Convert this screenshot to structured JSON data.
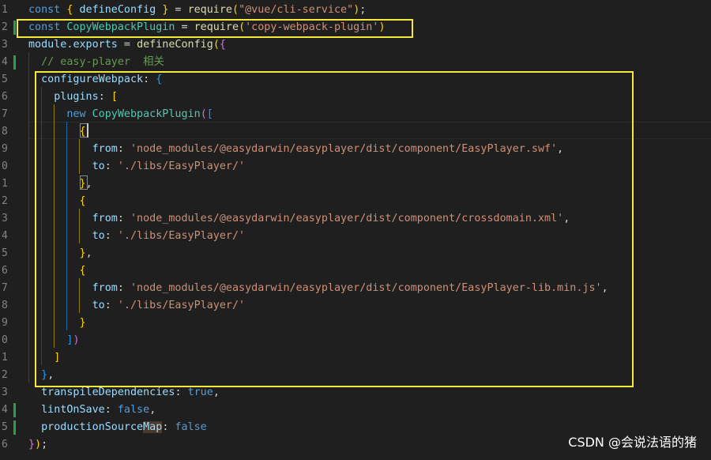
{
  "editor": {
    "lines": [
      {
        "n": "1",
        "tokens": [
          [
            "kw",
            "const "
          ],
          [
            "b1",
            "{ "
          ],
          [
            "var",
            "defineConfig "
          ],
          [
            "b1",
            "}"
          ],
          [
            "pl",
            " = "
          ],
          [
            "fn",
            "require"
          ],
          [
            "b1",
            "("
          ],
          [
            "str",
            "\"@vue/cli-service\""
          ],
          [
            "b1",
            ")"
          ],
          [
            "pl",
            ";"
          ]
        ]
      },
      {
        "n": "2",
        "tokens": [
          [
            "kw",
            "const "
          ],
          [
            "cls",
            "CopyWebpackPlugin"
          ],
          [
            "pl",
            " = "
          ],
          [
            "fn",
            "require"
          ],
          [
            "b1",
            "("
          ],
          [
            "str",
            "'copy-webpack-plugin'"
          ],
          [
            "b1",
            ")"
          ]
        ]
      },
      {
        "n": "3",
        "tokens": [
          [
            "var",
            "module"
          ],
          [
            "pl",
            "."
          ],
          [
            "var",
            "exports"
          ],
          [
            "pl",
            " = "
          ],
          [
            "fn",
            "defineConfig"
          ],
          [
            "b1",
            "("
          ],
          [
            "b2",
            "{"
          ]
        ]
      },
      {
        "n": "4",
        "tokens": [
          [
            "pl",
            "  "
          ],
          [
            "cm",
            "// easy-player  相关"
          ]
        ]
      },
      {
        "n": "5",
        "tokens": [
          [
            "pl",
            "  "
          ],
          [
            "prop",
            "configureWebpack"
          ],
          [
            "pl",
            ": "
          ],
          [
            "b3",
            "{"
          ]
        ]
      },
      {
        "n": "6",
        "tokens": [
          [
            "pl",
            "    "
          ],
          [
            "prop",
            "plugins"
          ],
          [
            "pl",
            ": "
          ],
          [
            "b1",
            "["
          ]
        ]
      },
      {
        "n": "7",
        "tokens": [
          [
            "pl",
            "      "
          ],
          [
            "kw",
            "new "
          ],
          [
            "cls",
            "CopyWebpackPlugin"
          ],
          [
            "b2",
            "("
          ],
          [
            "b3",
            "["
          ]
        ]
      },
      {
        "n": "8",
        "tokens": [
          [
            "pl",
            "        "
          ],
          [
            "b1",
            "{"
          ]
        ]
      },
      {
        "n": "9",
        "tokens": [
          [
            "pl",
            "          "
          ],
          [
            "prop",
            "from"
          ],
          [
            "pl",
            ": "
          ],
          [
            "str",
            "'node_modules/@easydarwin/easyplayer/dist/component/EasyPlayer.swf'"
          ],
          [
            "pl",
            ","
          ]
        ]
      },
      {
        "n": "0",
        "tokens": [
          [
            "pl",
            "          "
          ],
          [
            "prop",
            "to"
          ],
          [
            "pl",
            ": "
          ],
          [
            "str",
            "'./libs/EasyPlayer/'"
          ]
        ]
      },
      {
        "n": "1",
        "tokens": [
          [
            "pl",
            "        "
          ],
          [
            "b1",
            "}"
          ],
          [
            "pl",
            ","
          ]
        ]
      },
      {
        "n": "2",
        "tokens": [
          [
            "pl",
            "        "
          ],
          [
            "b1",
            "{"
          ]
        ]
      },
      {
        "n": "3",
        "tokens": [
          [
            "pl",
            "          "
          ],
          [
            "prop",
            "from"
          ],
          [
            "pl",
            ": "
          ],
          [
            "str",
            "'node_modules/@easydarwin/easyplayer/dist/component/crossdomain.xml'"
          ],
          [
            "pl",
            ","
          ]
        ]
      },
      {
        "n": "4",
        "tokens": [
          [
            "pl",
            "          "
          ],
          [
            "prop",
            "to"
          ],
          [
            "pl",
            ": "
          ],
          [
            "str",
            "'./libs/EasyPlayer/'"
          ]
        ]
      },
      {
        "n": "5",
        "tokens": [
          [
            "pl",
            "        "
          ],
          [
            "b1",
            "}"
          ],
          [
            "pl",
            ","
          ]
        ]
      },
      {
        "n": "6",
        "tokens": [
          [
            "pl",
            "        "
          ],
          [
            "b1",
            "{"
          ]
        ]
      },
      {
        "n": "7",
        "tokens": [
          [
            "pl",
            "          "
          ],
          [
            "prop",
            "from"
          ],
          [
            "pl",
            ": "
          ],
          [
            "str",
            "'node_modules/@easydarwin/easyplayer/dist/component/EasyPlayer-lib.min.js'"
          ],
          [
            "pl",
            ","
          ]
        ]
      },
      {
        "n": "8",
        "tokens": [
          [
            "pl",
            "          "
          ],
          [
            "prop",
            "to"
          ],
          [
            "pl",
            ": "
          ],
          [
            "str",
            "'./libs/EasyPlayer/'"
          ]
        ]
      },
      {
        "n": "9",
        "tokens": [
          [
            "pl",
            "        "
          ],
          [
            "b1",
            "}"
          ]
        ]
      },
      {
        "n": "0",
        "tokens": [
          [
            "pl",
            "      "
          ],
          [
            "b3",
            "]"
          ],
          [
            "b2",
            ")"
          ]
        ]
      },
      {
        "n": "1",
        "tokens": [
          [
            "pl",
            "    "
          ],
          [
            "b1",
            "]"
          ]
        ]
      },
      {
        "n": "2",
        "tokens": [
          [
            "pl",
            "  "
          ],
          [
            "b3",
            "}"
          ],
          [
            "pl",
            ","
          ]
        ]
      },
      {
        "n": "3",
        "tokens": [
          [
            "pl",
            "  "
          ],
          [
            "prop",
            "transpileDependencies"
          ],
          [
            "pl",
            ": "
          ],
          [
            "bool",
            "true"
          ],
          [
            "pl",
            ","
          ]
        ]
      },
      {
        "n": "4",
        "tokens": [
          [
            "pl",
            "  "
          ],
          [
            "prop",
            "lintOnSave"
          ],
          [
            "pl",
            ": "
          ],
          [
            "bool",
            "false"
          ],
          [
            "pl",
            ","
          ]
        ]
      },
      {
        "n": "5",
        "tokens": [
          [
            "pl",
            "  "
          ],
          [
            "prop",
            "productionSource"
          ],
          [
            "hl-map",
            "Map"
          ],
          [
            "pl",
            ": "
          ],
          [
            "bool",
            "false"
          ]
        ]
      },
      {
        "n": "6",
        "tokens": [
          [
            "b2",
            "}"
          ],
          [
            "b1",
            ")"
          ],
          [
            "pl",
            ";"
          ]
        ]
      }
    ],
    "modified_lines": [
      "2",
      "4",
      "24",
      "25"
    ],
    "colors": {
      "background": "#1f1f1f",
      "highlight_box": "#f5e83a",
      "modified_indicator": "#2ea043"
    }
  },
  "watermark": "CSDN @会说法语的猪"
}
